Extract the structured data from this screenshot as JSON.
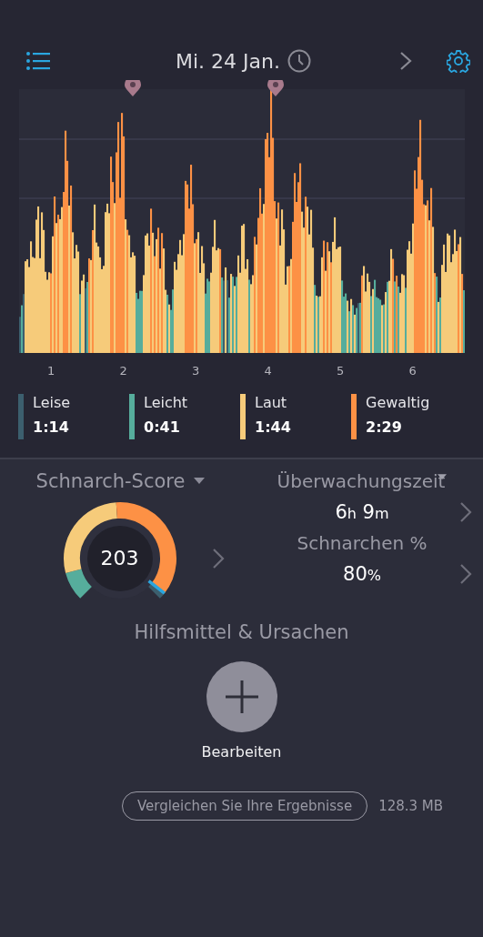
{
  "header": {
    "title": "Mi. 24 Jan."
  },
  "chart_axis": [
    "1",
    "2",
    "3",
    "4",
    "5",
    "6"
  ],
  "legend": [
    {
      "label": "Leise",
      "value": "1:14",
      "color": "#3c5f6e"
    },
    {
      "label": "Leicht",
      "value": "0:41",
      "color": "#56ad9c"
    },
    {
      "label": "Laut",
      "value": "1:44",
      "color": "#f6cb7a"
    },
    {
      "label": "Gewaltig",
      "value": "2:29",
      "color": "#fd9145"
    }
  ],
  "score": {
    "title": "Schnarch-Score",
    "value": "203"
  },
  "monitoring": {
    "title": "Überwachungszeit",
    "hours": "6",
    "hours_unit": "h",
    "minutes": "9",
    "minutes_unit": "m"
  },
  "snoring": {
    "title": "Schnarchen %",
    "value": "80",
    "unit": "%"
  },
  "remedies": {
    "title": "Hilfsmittel & Ursachen",
    "button": "Bearbeiten"
  },
  "footer": {
    "compare": "Vergleichen Sie Ihre Ergebnisse",
    "storage": "128.3 MB"
  }
}
